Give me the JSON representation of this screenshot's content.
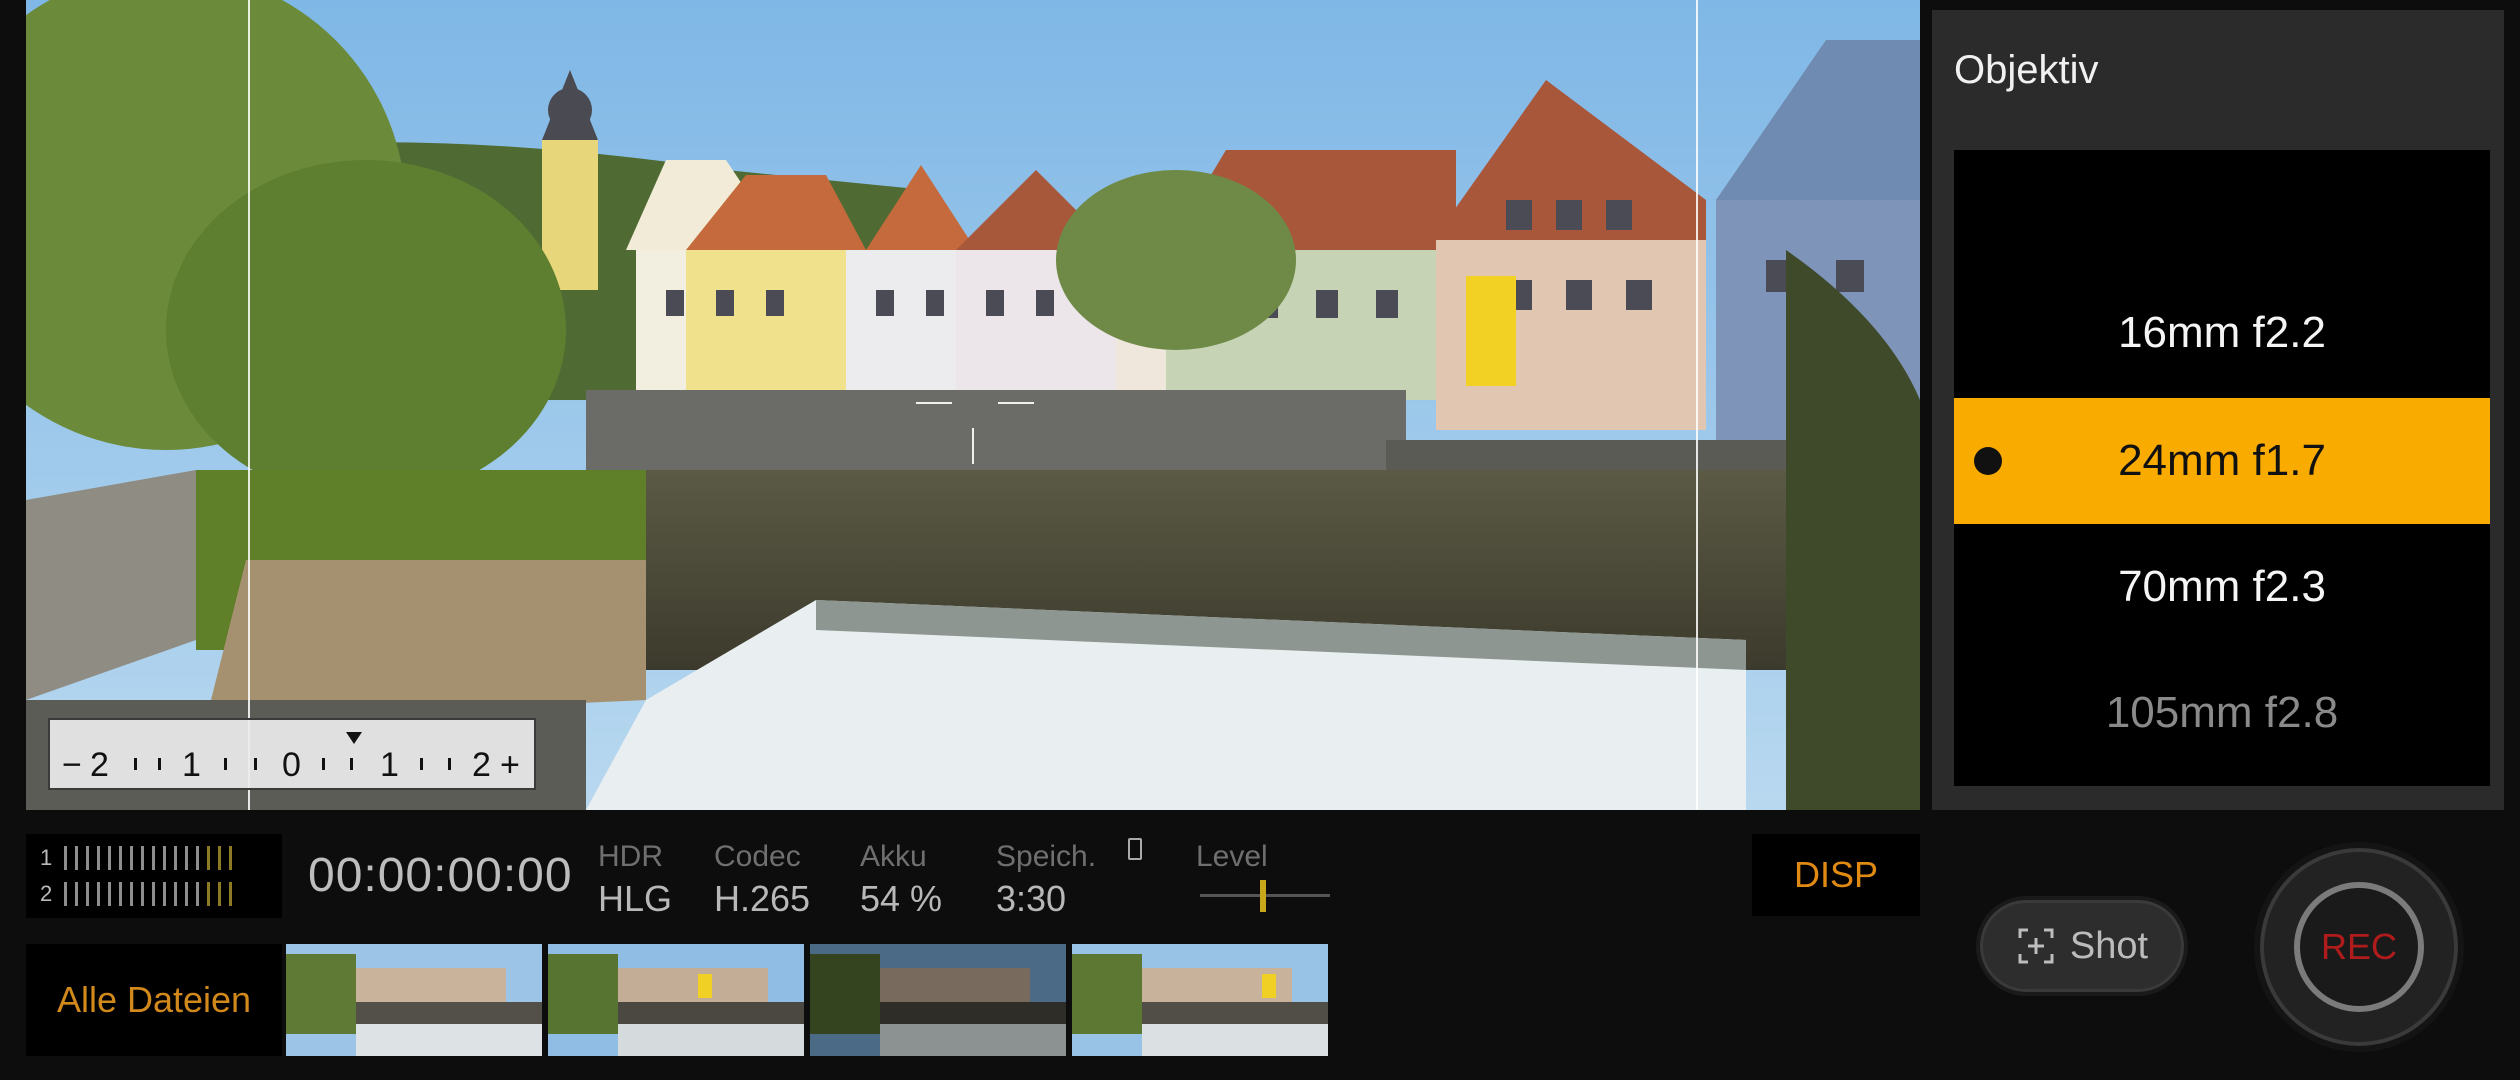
{
  "lens_panel": {
    "title": "Objektiv",
    "options": [
      {
        "label": "16mm f2.2",
        "selected": false
      },
      {
        "label": "24mm f1.7",
        "selected": true
      },
      {
        "label": "70mm f2.3",
        "selected": false
      },
      {
        "label": "105mm f2.8",
        "selected": false
      }
    ]
  },
  "exposure_scale": {
    "labels": [
      "−",
      "2",
      "1",
      "0",
      "1",
      "2",
      "+"
    ],
    "current_value": 0.3
  },
  "audio_meter": {
    "channels": [
      "1",
      "2"
    ]
  },
  "status": {
    "timecode": "00:00:00:00",
    "hdr_label": "HDR",
    "hdr_value": "HLG",
    "codec_label": "Codec",
    "codec_value": "H.265",
    "battery_label": "Akku",
    "battery_value": "54 %",
    "storage_label": "Speich.",
    "storage_value": "3:30",
    "level_label": "Level"
  },
  "disp_button": "DISP",
  "files": {
    "all_files_label": "Alle Dateien",
    "thumbnail_count": 4
  },
  "shot_button": "Shot",
  "rec_button": "REC",
  "colors": {
    "accent": "#f9ab00",
    "disp_text": "#e08a14",
    "rec_text": "#b01b1b"
  }
}
